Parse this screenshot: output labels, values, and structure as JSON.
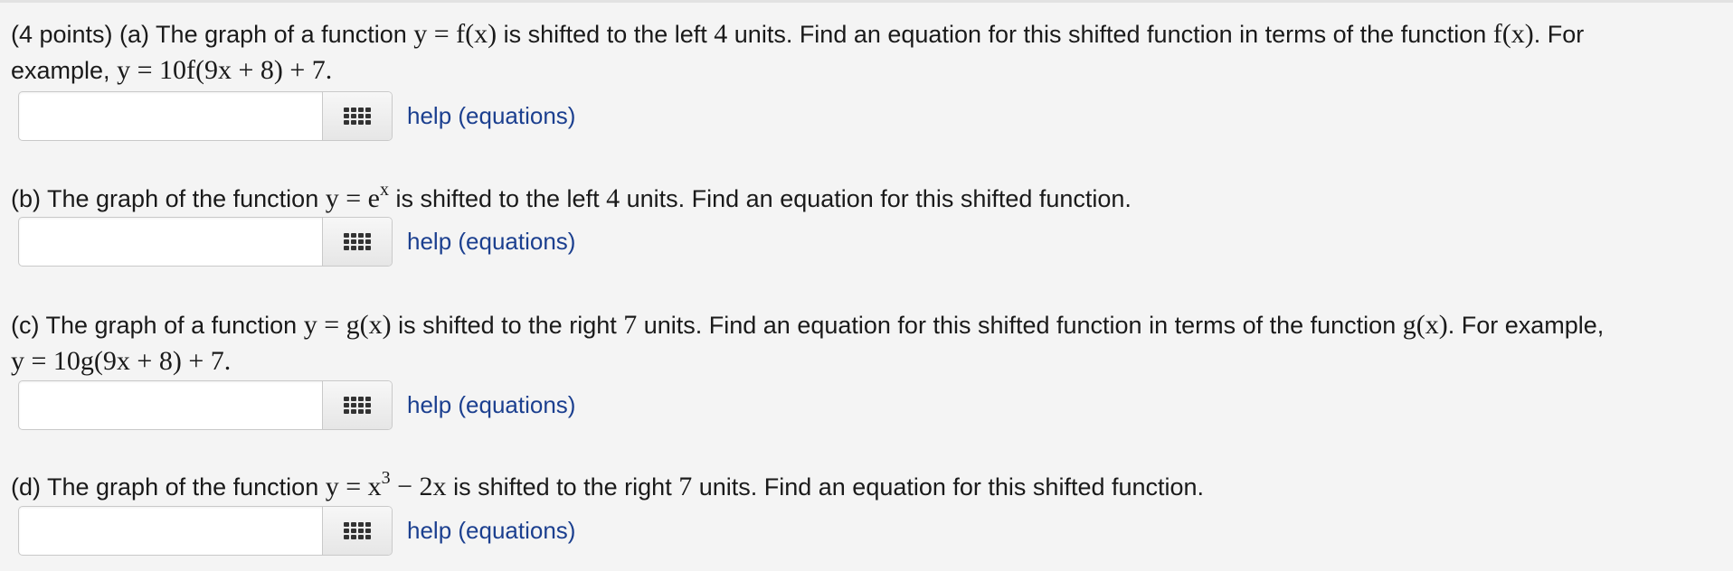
{
  "problems": [
    {
      "id": "a",
      "line1_prefix": "(4 points) (a) The graph of a function ",
      "line1_mid": " is shifted to the left ",
      "shift": "4",
      "line1_suffix": " units. Find an equation for this shifted function in terms of the function ",
      "line1_end": ". For",
      "line2_prefix": "example, ",
      "example": "y = 10f(9x + 8) + 7.",
      "func_eq": "y = f(x)",
      "func_name": "f(x)"
    },
    {
      "id": "b",
      "prefix": "(b) The graph of the function ",
      "mid": " is shifted to the left ",
      "shift": "4",
      "suffix": " units. Find an equation for this shifted function.",
      "func_base": "y = e",
      "func_exp": "x"
    },
    {
      "id": "c",
      "line1_prefix": "(c) The graph of a function ",
      "line1_mid": " is shifted to the right ",
      "shift": "7",
      "line1_suffix": " units. Find an equation for this shifted function in terms of the function ",
      "line1_end": ". For example,",
      "example": "y = 10g(9x + 8) + 7.",
      "func_eq": "y = g(x)",
      "func_name": "g(x)"
    },
    {
      "id": "d",
      "prefix": "(d) The graph of the function ",
      "mid": " is shifted to the right ",
      "shift": "7",
      "suffix": " units. Find an equation for this shifted function.",
      "func_base": "y = x",
      "func_exp": "3",
      "func_rest": " − 2x"
    }
  ],
  "answer": {
    "value": "",
    "help_label": "help (equations)",
    "palette_icon": "grid-icon"
  }
}
